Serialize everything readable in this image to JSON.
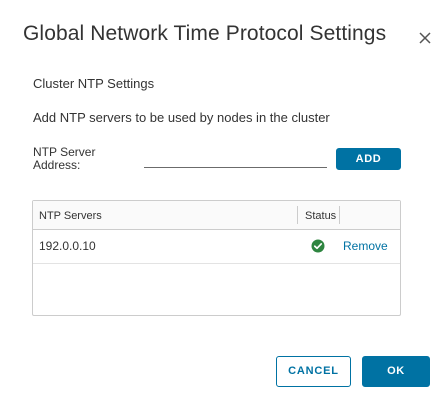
{
  "dialog": {
    "title": "Global Network Time Protocol Settings",
    "close_icon": "close-icon"
  },
  "section": {
    "title": "Cluster NTP Settings",
    "description": "Add NTP servers to be used by nodes in the cluster"
  },
  "ntp_input": {
    "label": "NTP Server Address:",
    "value": "",
    "placeholder": ""
  },
  "add_button": {
    "label": "ADD"
  },
  "grid": {
    "columns": [
      "NTP Servers",
      "Status"
    ],
    "rows": [
      {
        "server": "192.0.0.10",
        "status": "ok",
        "status_icon": "check-circle-icon",
        "status_color": "#2e8540",
        "action": "Remove"
      }
    ]
  },
  "footer": {
    "cancel_label": "CANCEL",
    "ok_label": "OK"
  },
  "colors": {
    "primary": "#0072a3",
    "success": "#2e8540",
    "text": "#333333",
    "border": "#cccccc"
  }
}
